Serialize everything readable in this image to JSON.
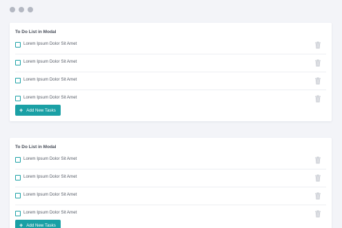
{
  "window": {
    "controls": [
      "dot",
      "dot",
      "dot"
    ]
  },
  "cards": [
    {
      "title": "To Do List in Modal",
      "tasks": [
        "Lorem Ipsum Dolor Sit Amet",
        "Lorem Ipsum Dolor Sit Amet",
        "Lorem Ipsum Dolor Sit Amet",
        "Lorem Ipsum Dolor Sit Amet"
      ],
      "add_button": {
        "icon": "+",
        "label": "Add New Tasks"
      }
    },
    {
      "title": "To Do List in Modal",
      "tasks": [
        "Lorem Ipsum Dolor Sit Amet",
        "Lorem Ipsum Dolor Sit Amet",
        "Lorem Ipsum Dolor Sit Amet",
        "Lorem Ipsum Dolor Sit Amet"
      ],
      "add_button": {
        "icon": "+",
        "label": "Add New Tasks"
      }
    }
  ],
  "colors": {
    "accent": "#1aa0a5",
    "background": "#f3f4f8",
    "card": "#ffffff",
    "trash_icon": "#c9ccd3"
  },
  "icons": {
    "task_action": "trash-icon",
    "add": "plus-icon",
    "checkbox": "checkbox-unchecked"
  }
}
